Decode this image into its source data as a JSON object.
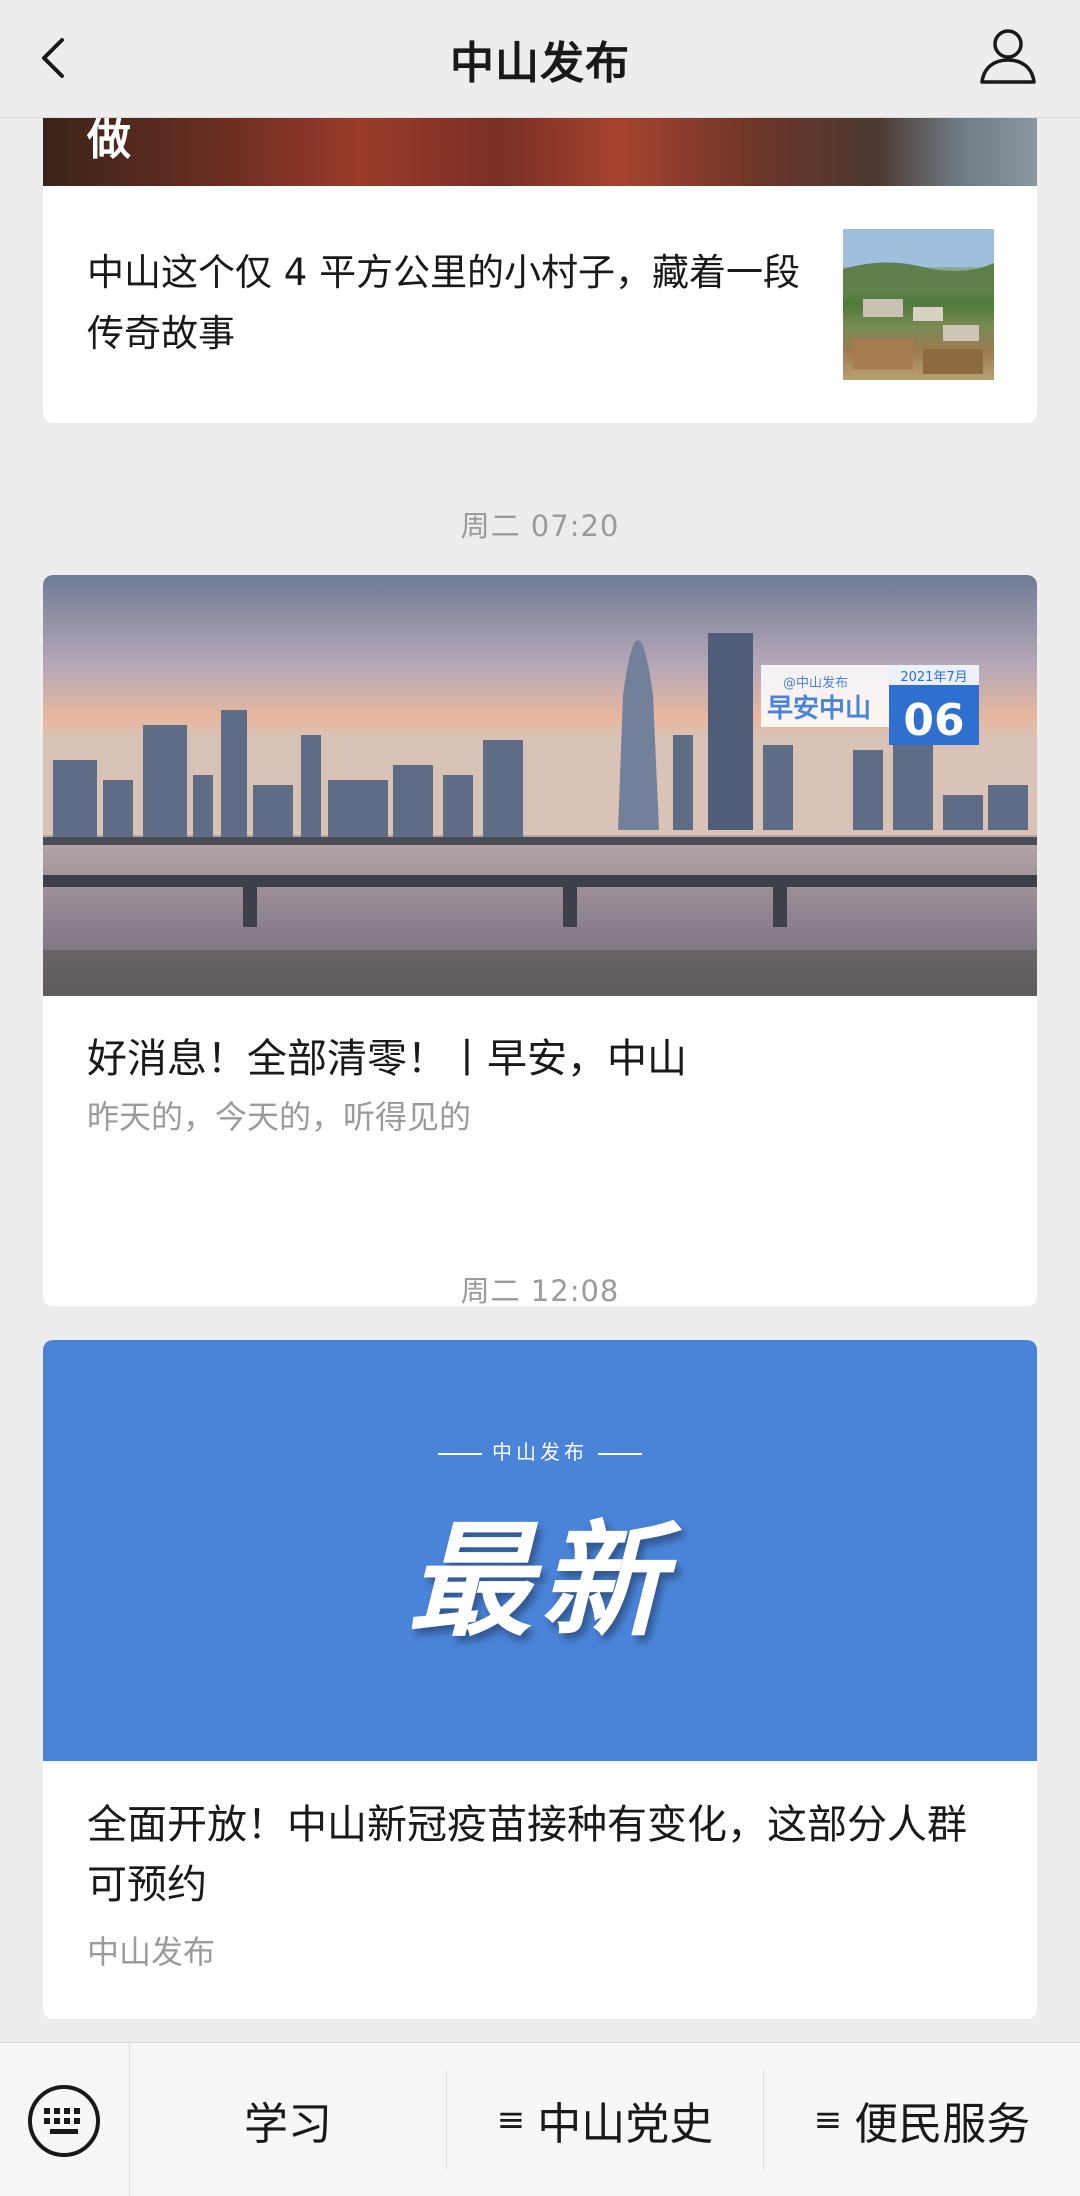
{
  "navbar": {
    "title": "中山发布",
    "back_icon": "chevron-left-icon",
    "profile_icon": "person-icon"
  },
  "feed": {
    "card1": {
      "banner_text": "做",
      "title": "中山这个仅 4 平方公里的小村子，藏着一段传奇故事"
    },
    "ts1": "周二 07:20",
    "card2": {
      "badge_brand": "@中山发布",
      "badge_title": "早安中山",
      "badge_month": "2021年7月",
      "badge_day": "06",
      "title": "好消息！全部清零！丨早安，中山",
      "subtitle": "昨天的，今天的，听得见的"
    },
    "ts2": "周二 12:08",
    "card3": {
      "kicker": "中山发布",
      "headline": "最新",
      "title": "全面开放！中山新冠疫苗接种有变化，这部分人群可预约",
      "subtitle": "中山发布"
    }
  },
  "bottom_menu": {
    "keyboard_icon": "keyboard-icon",
    "items": [
      {
        "label": "学习",
        "has_menu_icon": false
      },
      {
        "label": "中山党史",
        "has_menu_icon": true
      },
      {
        "label": "便民服务",
        "has_menu_icon": true
      }
    ],
    "menu_icon_glyph": "≡"
  },
  "colors": {
    "background": "#ededed",
    "card": "#ffffff",
    "banner_blue": "#4a84d9",
    "secondary_text": "#9b9b9b"
  }
}
